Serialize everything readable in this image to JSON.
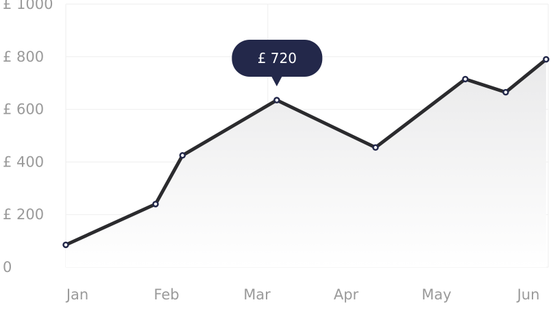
{
  "chart_data": {
    "type": "area",
    "title": "",
    "xlabel": "",
    "ylabel": "",
    "ylim": [
      0,
      1000
    ],
    "y_ticks": [
      {
        "value": 0,
        "label": "0"
      },
      {
        "value": 200,
        "label": "£ 200"
      },
      {
        "value": 400,
        "label": "£ 400"
      },
      {
        "value": 600,
        "label": "£ 600"
      },
      {
        "value": 800,
        "label": "£ 800"
      },
      {
        "value": 1000,
        "label": "£ 1000"
      }
    ],
    "x_ticks": [
      {
        "value": 0,
        "label": "Jan"
      },
      {
        "value": 1,
        "label": "Feb"
      },
      {
        "value": 2,
        "label": "Mar"
      },
      {
        "value": 3,
        "label": "Apr"
      },
      {
        "value": 4,
        "label": "May"
      },
      {
        "value": 5,
        "label": "Jun"
      }
    ],
    "series": [
      {
        "points": [
          {
            "x": 0.0,
            "y": 85
          },
          {
            "x": 1.0,
            "y": 240
          },
          {
            "x": 1.3,
            "y": 425
          },
          {
            "x": 2.35,
            "y": 635
          },
          {
            "x": 3.45,
            "y": 455
          },
          {
            "x": 4.45,
            "y": 715
          },
          {
            "x": 4.9,
            "y": 665
          },
          {
            "x": 5.35,
            "y": 790
          }
        ]
      }
    ],
    "tooltip": {
      "label": "£ 720",
      "point_index": 3
    },
    "grid": true,
    "colors": {
      "line": "#2b2b2e",
      "marker_stroke": "#23284a",
      "marker_fill": "#ffffff",
      "tooltip_bg": "#23284a",
      "area_top": "#e9e9ea",
      "area_bottom": "#ffffff"
    }
  }
}
